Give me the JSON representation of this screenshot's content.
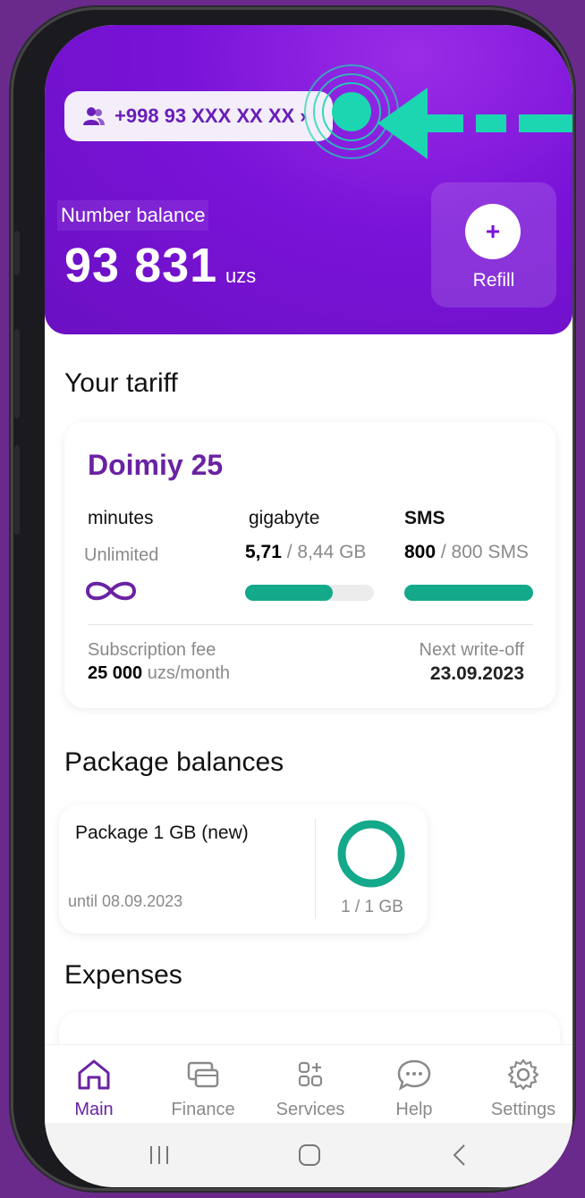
{
  "header": {
    "phone_number": "+998 93 XXX XX XX",
    "balance_label": "Number balance",
    "balance_amount": "93 831",
    "balance_unit": "uzs",
    "refill_icon_text": "+",
    "refill_label": "Refill"
  },
  "tariff": {
    "section_title": "Your tariff",
    "name": "Doimiy 25",
    "minutes": {
      "label": "minutes",
      "value": "Unlimited",
      "icon": "infinity-icon"
    },
    "gigabyte": {
      "label": "gigabyte",
      "used": "5,71",
      "total": "/ 8,44 GB",
      "fraction": 0.68
    },
    "sms": {
      "label": "SMS",
      "used": "800",
      "total": "/ 800 SMS",
      "fraction": 1.0
    },
    "fee_label": "Subscription fee",
    "fee_value": "25 000",
    "fee_unit": "uzs/month",
    "writeoff_label": "Next write-off",
    "writeoff_date": "23.09.2023"
  },
  "packages": {
    "section_title": "Package balances",
    "items": [
      {
        "name": "Package 1 GB (new)",
        "until_label": "until",
        "until_date": "08.09.2023",
        "amount": "1 / 1 GB",
        "fraction": 1.0
      }
    ]
  },
  "expenses": {
    "section_title": "Expenses"
  },
  "nav": {
    "items": [
      {
        "label": "Main",
        "icon": "home-icon",
        "active": true
      },
      {
        "label": "Finance",
        "icon": "card-icon",
        "active": false
      },
      {
        "label": "Services",
        "icon": "grid-plus-icon",
        "active": false
      },
      {
        "label": "Help",
        "icon": "chat-icon",
        "active": false
      },
      {
        "label": "Settings",
        "icon": "gear-icon",
        "active": false
      }
    ]
  },
  "colors": {
    "brand_purple": "#7a13d8",
    "accent_green": "#13a98a",
    "annotation_teal": "#1bd6b0"
  }
}
